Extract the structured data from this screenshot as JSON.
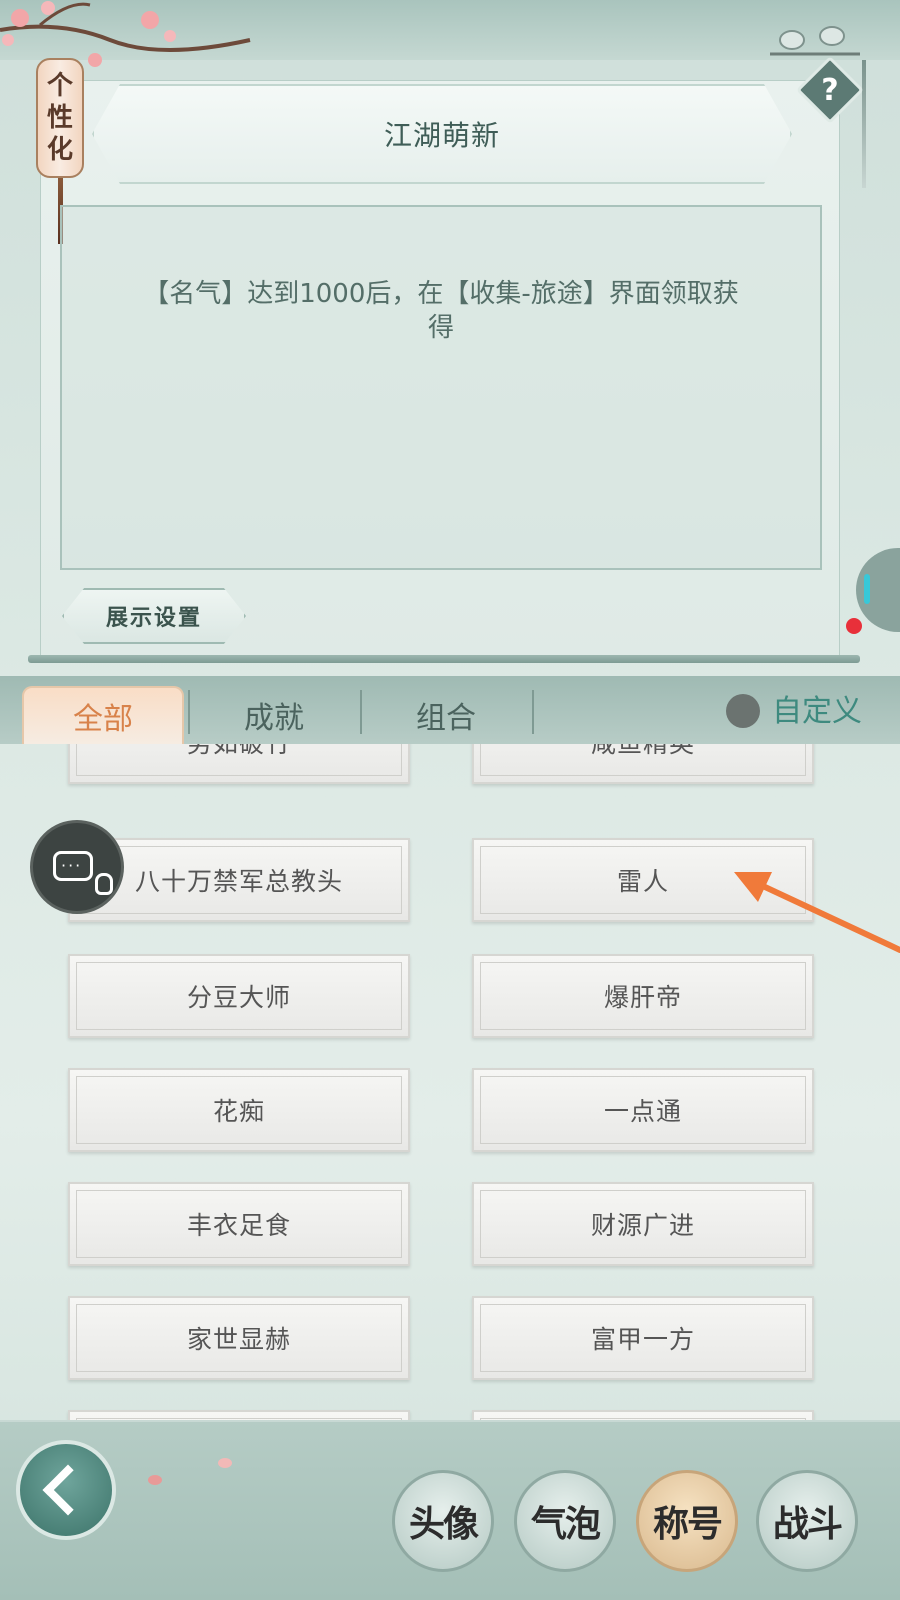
{
  "header": {
    "lantern_label": "个性化",
    "help_label": "?"
  },
  "selected_title": {
    "name": "江湖萌新",
    "description": "【名气】达到1000后，在【收集-旅途】界面领取获得",
    "display_button": "展示设置"
  },
  "tabs": [
    {
      "label": "全部",
      "active": true
    },
    {
      "label": "成就",
      "active": false
    },
    {
      "label": "组合",
      "active": false
    }
  ],
  "custom_label": "自定义",
  "titles": [
    "势如破竹",
    "咸鱼精英",
    "八十万禁军总教头",
    "雷人",
    "分豆大师",
    "爆肝帝",
    "花痴",
    "一点通",
    "丰衣足食",
    "财源广进",
    "家世显赫",
    "富甲一方",
    "",
    ""
  ],
  "bottom_nav": [
    {
      "label": "头像",
      "active": false
    },
    {
      "label": "气泡",
      "active": false
    },
    {
      "label": "称号",
      "active": true
    },
    {
      "label": "战斗",
      "active": false
    }
  ],
  "colors": {
    "accent": "#d8824a",
    "arrow": "#f07a3a",
    "custom": "#3e8a7f"
  }
}
